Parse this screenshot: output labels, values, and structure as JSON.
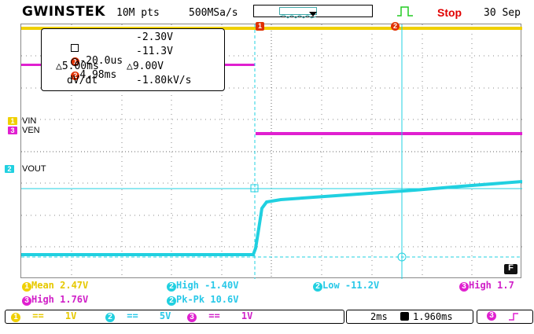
{
  "header": {
    "brand": "GWINSTEK",
    "points": "10M pts",
    "sample_rate": "500MSa/s",
    "run_state": "Stop",
    "date": "30 Sep"
  },
  "channels": [
    {
      "id": "1",
      "label": "VIN",
      "color": "#f0d000"
    },
    {
      "id": "3",
      "label": "VEN",
      "color": "#e020d0"
    },
    {
      "id": "2",
      "label": "VOUT",
      "color": "#20d0e0"
    }
  ],
  "cursors": {
    "c1_time": "-20.0us",
    "c1_val": "-2.30V",
    "c2_time": "4.98ms",
    "c2_val": "-11.3V",
    "delta_time": "△5.00ms",
    "delta_val": "△9.00V",
    "rate_label": "dV/dt",
    "rate_val": "-1.80kV/s",
    "c1_tag": "1",
    "c2_tag": "2"
  },
  "measurements": {
    "row1": [
      {
        "ch": "1",
        "text": "Mean 2.47V"
      },
      {
        "ch": "2",
        "text": "High -1.40V"
      },
      {
        "ch": "2",
        "text": "Low -11.2V"
      },
      {
        "ch": "3",
        "text": "High 1.7"
      }
    ],
    "row2": [
      {
        "ch": "3",
        "text": "High 1.76V"
      },
      {
        "ch": "2",
        "text": "Pk-Pk 10.6V"
      }
    ]
  },
  "footer": {
    "ch1_scale": "1V",
    "ch2_scale": "5V",
    "ch3_scale": "1V",
    "ch1": "1",
    "ch2": "2",
    "ch3": "3",
    "timebase": "2ms",
    "trigger_pos": "1.960ms",
    "trig_ch": "3",
    "coupling": "==",
    "f_label": "F"
  },
  "colors": {
    "ch1": "#f0d000",
    "ch2": "#20d0e0",
    "ch3": "#e020d0",
    "trigger": "#e03000"
  }
}
